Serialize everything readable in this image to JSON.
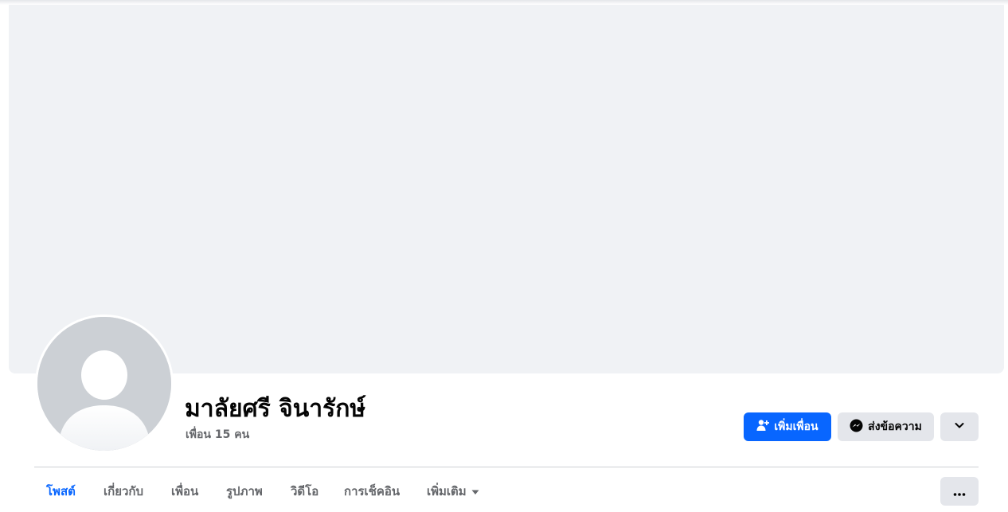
{
  "profile": {
    "name": "มาลัยศรี จินารักษ์",
    "friends_count": "เพื่อน 15 คน"
  },
  "actions": {
    "add_friend_label": "เพิ่มเพื่อน",
    "add_friend_icon": "person-add-icon",
    "message_label": "ส่งข้อความ",
    "message_icon": "messenger-icon",
    "more_icon": "chevron-down-icon"
  },
  "tabs": [
    {
      "label": "โพสต์",
      "active": true
    },
    {
      "label": "เกี่ยวกับ",
      "active": false
    },
    {
      "label": "เพื่อน",
      "active": false
    },
    {
      "label": "รูปภาพ",
      "active": false
    },
    {
      "label": "วิดีโอ",
      "active": false
    },
    {
      "label": "การเช็คอิน",
      "active": false
    },
    {
      "label": "เพิ่มเติม",
      "active": false,
      "icon": "caret-down-icon"
    }
  ],
  "tab_more_icon": "ellipsis-icon",
  "colors": {
    "accent": "#0866ff",
    "cover_bg": "#f0f2f5",
    "button_bg": "#e4e6eb",
    "text_primary": "#050505",
    "text_secondary": "#65676b"
  }
}
